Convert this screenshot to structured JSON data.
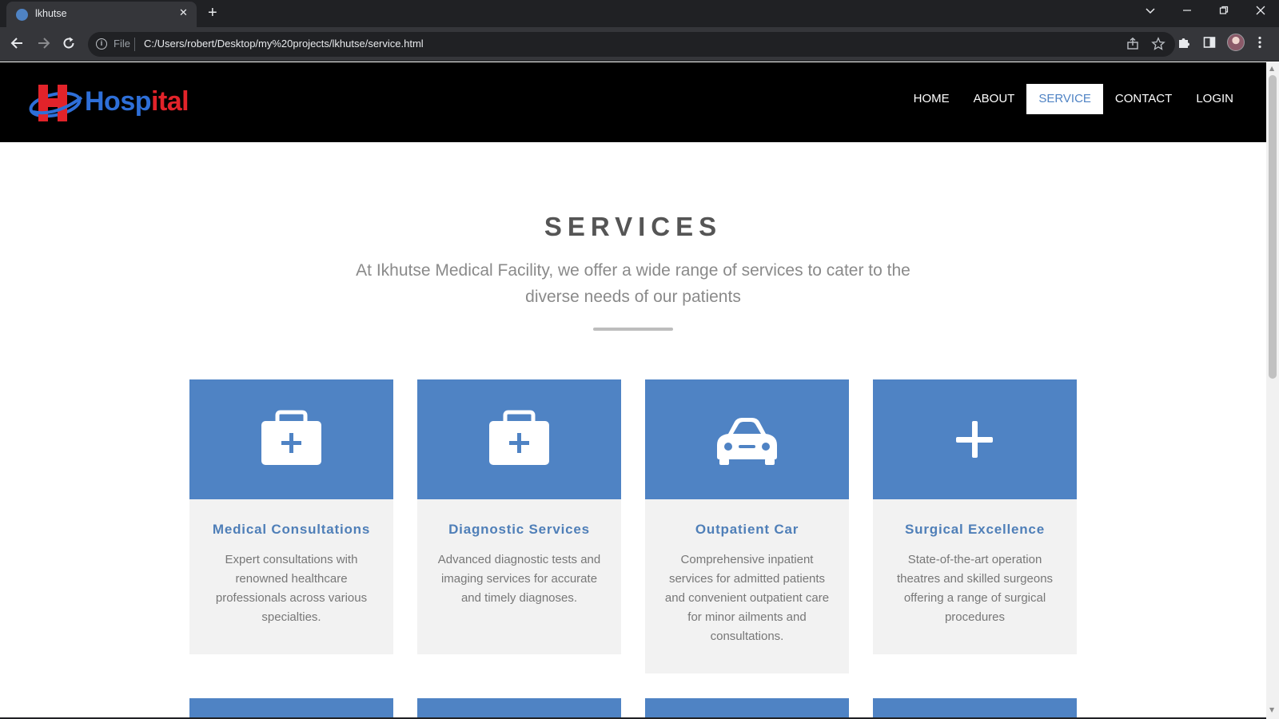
{
  "browser": {
    "tab_title": "lkhutse",
    "tab_close": "✕",
    "new_tab": "+",
    "address": {
      "scheme_label": "File",
      "url": "C:/Users/robert/Desktop/my%20projects/lkhutse/service.html"
    },
    "icons": {
      "back": "back-arrow-icon",
      "forward": "forward-arrow-icon",
      "reload": "reload-icon",
      "info": "info-icon",
      "share": "share-icon",
      "bookmark": "star-icon",
      "extensions": "puzzle-icon",
      "sidepanel": "side-panel-icon",
      "menu": "kebab-menu-icon"
    }
  },
  "site": {
    "logo": {
      "letter": "H",
      "text_blue": "Hosp",
      "text_red": "ital"
    },
    "nav": [
      {
        "label": "HOME",
        "active": false
      },
      {
        "label": "ABOUT",
        "active": false
      },
      {
        "label": "SERVICE",
        "active": true
      },
      {
        "label": "CONTACT",
        "active": false
      },
      {
        "label": "LOGIN",
        "active": false
      }
    ],
    "colors": {
      "accent": "#4f83c4",
      "header_bg": "#000000",
      "card_bg": "#f2f2f2",
      "logo_blue": "#2e6fd8",
      "logo_red": "#e2232a"
    }
  },
  "services": {
    "title": "SERVICES",
    "subtitle": "At Ikhutse Medical Facility, we offer a wide range of services to cater to the diverse needs of our patients",
    "cards": [
      {
        "icon": "medical-kit-icon",
        "title": "Medical Consultations",
        "description": "Expert consultations with renowned healthcare professionals across various specialties."
      },
      {
        "icon": "medical-kit-icon",
        "title": "Diagnostic Services",
        "description": "Advanced diagnostic tests and imaging services for accurate and timely diagnoses."
      },
      {
        "icon": "car-icon",
        "title": "Outpatient Car",
        "description": "Comprehensive inpatient services for admitted patients and convenient outpatient care for minor ailments and consultations."
      },
      {
        "icon": "plus-icon",
        "title": "Surgical Excellence",
        "description": "State-of-the-art operation theatres and skilled surgeons offering a range of surgical procedures"
      }
    ]
  }
}
